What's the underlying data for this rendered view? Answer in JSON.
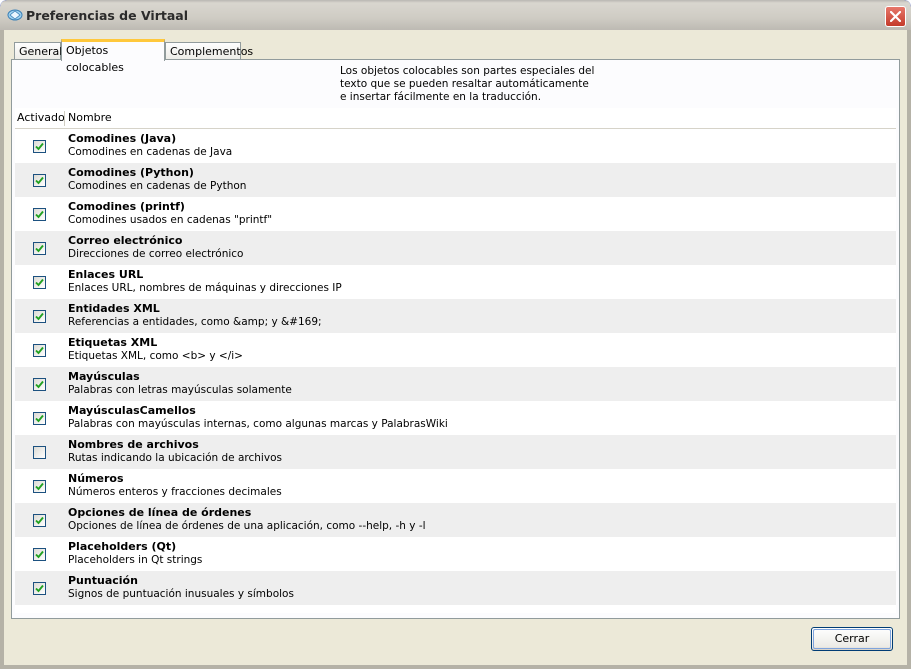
{
  "window": {
    "title": "Preferencias de Virtaal"
  },
  "tabs": [
    {
      "label": "General",
      "active": false
    },
    {
      "label": "Objetos colocables",
      "active": true
    },
    {
      "label": "Complementos",
      "active": false
    }
  ],
  "description": [
    "Los objetos colocables son partes especiales del",
    "texto que se pueden resaltar automáticamente",
    "e insertar fácilmente en la traducción."
  ],
  "columns": {
    "enabled": "Activado",
    "name": "Nombre"
  },
  "placeables": [
    {
      "name": "Comodines (Java)",
      "desc": "Comodines en cadenas de Java",
      "checked": true
    },
    {
      "name": "Comodines (Python)",
      "desc": "Comodines en cadenas de Python",
      "checked": true
    },
    {
      "name": "Comodines (printf)",
      "desc": "Comodines usados en cadenas \"printf\"",
      "checked": true
    },
    {
      "name": "Correo electrónico",
      "desc": "Direcciones de correo electrónico",
      "checked": true
    },
    {
      "name": "Enlaces URL",
      "desc": "Enlaces URL, nombres de máquinas y direcciones IP",
      "checked": true
    },
    {
      "name": "Entidades XML",
      "desc": "Referencias a entidades, como &amp; y &#169;",
      "checked": true
    },
    {
      "name": "Etiquetas XML",
      "desc": "Etiquetas XML, como <b> y </i>",
      "checked": true
    },
    {
      "name": "Mayúsculas",
      "desc": "Palabras con letras mayúsculas solamente",
      "checked": true
    },
    {
      "name": "MayúsculasCamellos",
      "desc": "Palabras con mayúsculas internas, como algunas marcas y PalabrasWiki",
      "checked": true
    },
    {
      "name": "Nombres de archivos",
      "desc": "Rutas indicando la ubicación de archivos",
      "checked": false
    },
    {
      "name": "Números",
      "desc": "Números enteros y fracciones decimales",
      "checked": true
    },
    {
      "name": "Opciones de línea de órdenes",
      "desc": "Opciones de línea de órdenes de una aplicación, como --help, -h y -l",
      "checked": true
    },
    {
      "name": "Placeholders (Qt)",
      "desc": "Placeholders in Qt strings",
      "checked": true
    },
    {
      "name": "Puntuación",
      "desc": "Signos de puntuación inusuales y símbolos",
      "checked": true
    }
  ],
  "buttons": {
    "close": "Cerrar"
  },
  "icons": {
    "app": "virtaal-icon",
    "close": "close-icon",
    "check": "checkmark-icon"
  },
  "colors": {
    "title_bar": "#d9d6cf",
    "close_button": "#c43b2b",
    "active_tab_accent": "#ffc83c",
    "check": "#21a121"
  }
}
